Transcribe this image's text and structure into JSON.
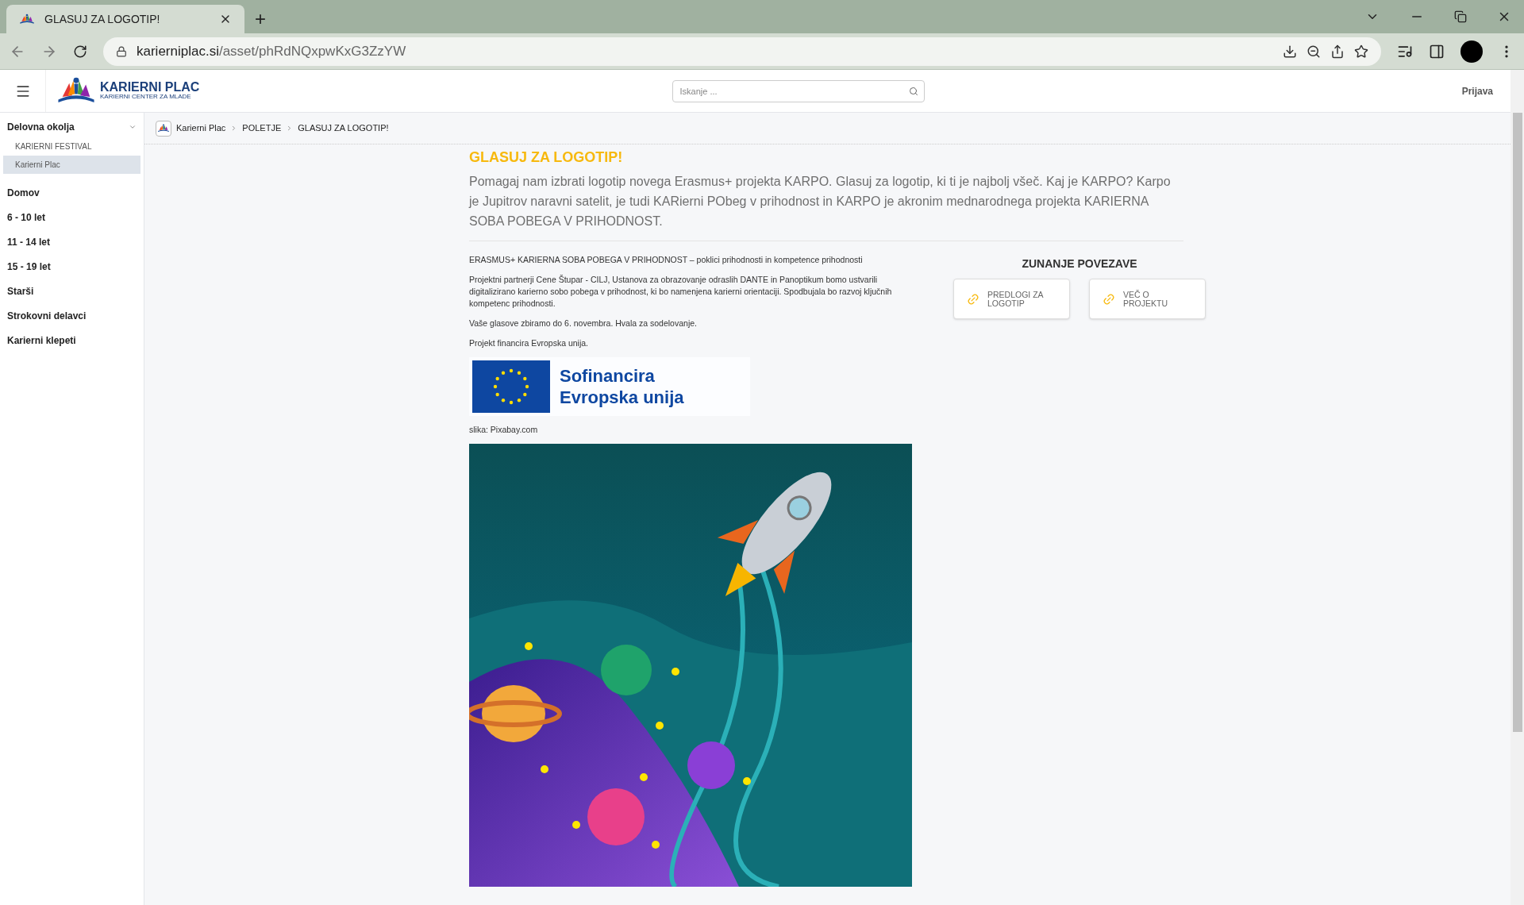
{
  "browser": {
    "tab_title": "GLASUJ ZA LOGOTIP!",
    "new_tab": "+",
    "url_domain": "karierniplac.si",
    "url_path": "/asset/phRdNQxpwKxG3ZzYW"
  },
  "header": {
    "logo_title": "KARIERNI PLAC",
    "logo_subtitle": "KARIERNI CENTER ZA MLADE",
    "search": {
      "placeholder": "Iskanje ..."
    },
    "login": "Prijava"
  },
  "sidebar": {
    "section": {
      "label": "Delovna okolja",
      "expanded": true
    },
    "subitems": [
      {
        "label": "KARIERNI FESTIVAL",
        "selected": false
      },
      {
        "label": "Karierni Plac",
        "selected": true
      }
    ],
    "items": [
      "Domov",
      "6 - 10 let",
      "11 - 14 let",
      "15 - 19 let",
      "Starši",
      "Strokovni delavci",
      "Karierni klepeti"
    ]
  },
  "breadcrumb": [
    "Karierni Plac",
    "POLETJE",
    "GLASUJ ZA LOGOTIP!"
  ],
  "article": {
    "title": "GLASUJ ZA LOGOTIP!",
    "intro": "Pomagaj nam izbrati logotip novega Erasmus+ projekta KARPO. Glasuj za logotip, ki ti je najbolj všeč. Kaj je KARPO? Karpo je Jupitrov naravni satelit, je tudi KARierni PObeg v prihodnost in KARPO je akronim mednarodnega projekta KARIERNA SOBA POBEGA V PRIHODNOST.",
    "paragraphs": [
      "ERASMUS+ KARIERNA SOBA POBEGA V PRIHODNOST – poklici prihodnosti in kompetence prihodnosti",
      "Projektni partnerji Cene Štupar - CILJ, Ustanova za obrazovanje odraslih DANTE in Panoptikum bomo ustvarili digitalizirano karierno sobo pobega v prihodnost, ki bo namenjena karierni orientaciji. Spodbujala bo razvoj ključnih kompetenc prihodnosti.",
      "Vaše glasove zbiramo do 6. novembra. Hvala za sodelovanje.",
      "Projekt financira Evropska unija."
    ],
    "eu_banner": [
      "Sofinancira",
      "Evropska unija"
    ],
    "caption": "slika: Pixabay.com"
  },
  "external_links": {
    "title": "ZUNANJE POVEZAVE",
    "links": [
      "PREDLOGI ZA LOGOTIP",
      "VEČ O PROJEKTU"
    ]
  }
}
